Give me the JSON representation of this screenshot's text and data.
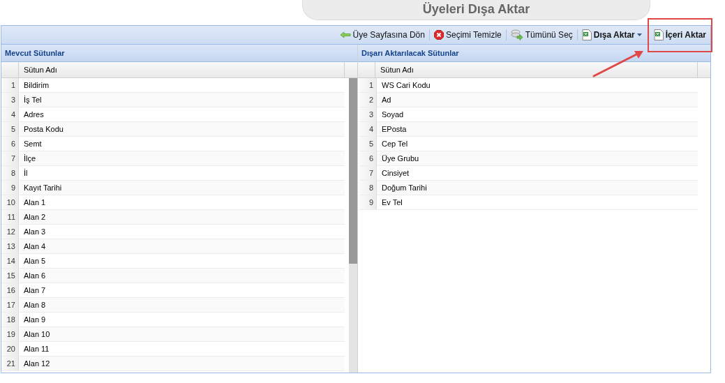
{
  "title": "Üyeleri Dışa Aktar",
  "toolbar": [
    {
      "label": "Üye Sayfasına Dön",
      "kind": "back",
      "bold": false,
      "dropdown": false,
      "highlighted": false
    },
    {
      "label": "Seçimi Temizle",
      "kind": "clear",
      "bold": false,
      "dropdown": false,
      "highlighted": false
    },
    {
      "label": "Tümünü Seç",
      "kind": "select-all",
      "bold": false,
      "dropdown": false,
      "highlighted": false
    },
    {
      "label": "Dışa Aktar",
      "kind": "excel",
      "bold": true,
      "dropdown": true,
      "highlighted": false
    },
    {
      "label": "İçeri Aktar",
      "kind": "excel",
      "bold": true,
      "dropdown": false,
      "highlighted": true
    }
  ],
  "panels": [
    {
      "title": "Mevcut Sütunlar",
      "column": "Sütun Adı",
      "scrollbar": true,
      "rows": [
        {
          "number": "1",
          "name": "Bildirim"
        },
        {
          "number": "3",
          "name": "İş Tel"
        },
        {
          "number": "4",
          "name": "Adres"
        },
        {
          "number": "5",
          "name": "Posta Kodu"
        },
        {
          "number": "6",
          "name": "Semt"
        },
        {
          "number": "7",
          "name": "İlçe"
        },
        {
          "number": "8",
          "name": "İl"
        },
        {
          "number": "9",
          "name": "Kayıt Tarihi"
        },
        {
          "number": "10",
          "name": "Alan 1"
        },
        {
          "number": "11",
          "name": "Alan 2"
        },
        {
          "number": "12",
          "name": "Alan 3"
        },
        {
          "number": "13",
          "name": "Alan 4"
        },
        {
          "number": "14",
          "name": "Alan 5"
        },
        {
          "number": "15",
          "name": "Alan 6"
        },
        {
          "number": "16",
          "name": "Alan 7"
        },
        {
          "number": "17",
          "name": "Alan 8"
        },
        {
          "number": "18",
          "name": "Alan 9"
        },
        {
          "number": "19",
          "name": "Alan 10"
        },
        {
          "number": "20",
          "name": "Alan 11"
        },
        {
          "number": "21",
          "name": "Alan 12"
        }
      ]
    },
    {
      "title": "Dışarı Aktarılacak Sütunlar",
      "column": "Sütun Adı",
      "scrollbar": false,
      "rows": [
        {
          "number": "1",
          "name": "WS Cari Kodu"
        },
        {
          "number": "2",
          "name": "Ad"
        },
        {
          "number": "3",
          "name": "Soyad"
        },
        {
          "number": "4",
          "name": "EPosta"
        },
        {
          "number": "5",
          "name": "Cep Tel"
        },
        {
          "number": "6",
          "name": "Üye Grubu"
        },
        {
          "number": "7",
          "name": "Cinsiyet"
        },
        {
          "number": "8",
          "name": "Doğum Tarihi"
        },
        {
          "number": "9",
          "name": "Ev Tel"
        }
      ]
    }
  ]
}
